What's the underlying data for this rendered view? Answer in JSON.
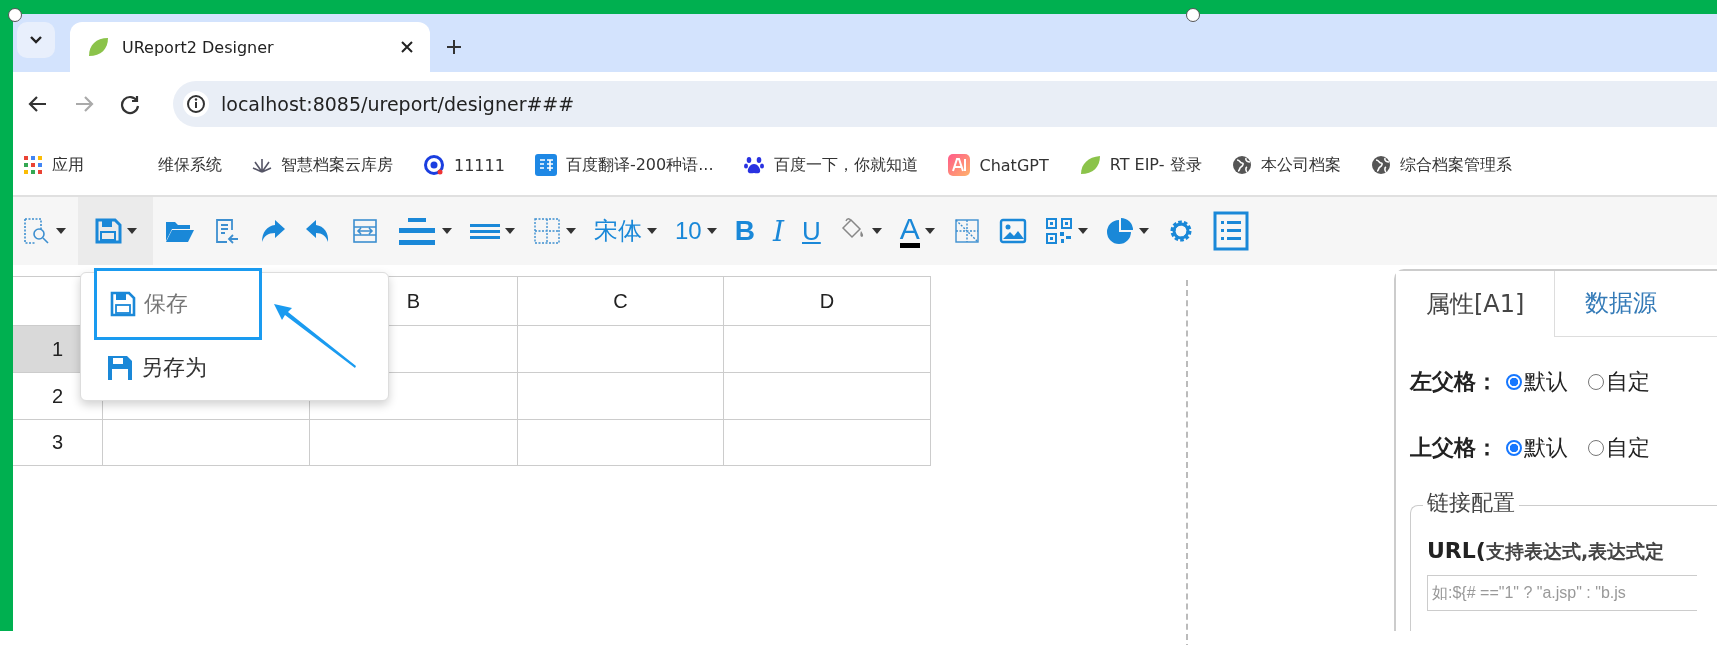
{
  "browser": {
    "tab": {
      "title": "UReport2 Designer",
      "selected": true
    },
    "nav": [
      {
        "kind": "back",
        "disabled": false
      },
      {
        "kind": "forward",
        "disabled": true
      },
      {
        "kind": "reload",
        "disabled": false
      }
    ],
    "url": "localhost:8085/ureport/designer###",
    "bookmarks": [
      {
        "kind": "apps",
        "label": "应用"
      },
      {
        "kind": "none",
        "label": "维保系统"
      },
      {
        "kind": "plant",
        "label": "智慧档案云库房"
      },
      {
        "kind": "ring",
        "label": "11111"
      },
      {
        "kind": "translate",
        "label": "百度翻译-200种语..."
      },
      {
        "kind": "paw",
        "label": "百度一下，你就知道"
      },
      {
        "kind": "ai",
        "label": "ChatGPT"
      },
      {
        "kind": "leaf",
        "label": "RT EIP- 登录"
      },
      {
        "kind": "globe",
        "label": "本公司档案"
      },
      {
        "kind": "globe",
        "label": "综合档案管理系"
      }
    ]
  },
  "toolbar": [
    {
      "kind": "preview",
      "dropdown": true,
      "pressed": false
    },
    {
      "kind": "save",
      "dropdown": true,
      "pressed": true
    },
    {
      "kind": "open",
      "dropdown": false,
      "pressed": false
    },
    {
      "kind": "import",
      "dropdown": false,
      "pressed": false
    },
    {
      "kind": "redo",
      "dropdown": false,
      "pressed": false
    },
    {
      "kind": "undo",
      "dropdown": false,
      "pressed": false
    },
    {
      "kind": "merge",
      "dropdown": false,
      "pressed": false
    },
    {
      "kind": "align",
      "dropdown": true,
      "pressed": false
    },
    {
      "kind": "valign",
      "dropdown": true,
      "pressed": false
    },
    {
      "kind": "border",
      "dropdown": true,
      "pressed": false
    },
    {
      "kind": "text",
      "text": "宋体",
      "dropdown": true,
      "pressed": false
    },
    {
      "kind": "text",
      "text": "10",
      "dropdown": true,
      "pressed": false
    },
    {
      "kind": "bold",
      "text": "B",
      "dropdown": false,
      "pressed": false
    },
    {
      "kind": "italic",
      "text": "I",
      "dropdown": false,
      "pressed": false
    },
    {
      "kind": "underline",
      "text": "U",
      "dropdown": false,
      "pressed": false
    },
    {
      "kind": "fill",
      "dropdown": true,
      "pressed": false
    },
    {
      "kind": "color",
      "text": "A",
      "dropdown": true,
      "pressed": false
    },
    {
      "kind": "noborder",
      "dropdown": false,
      "pressed": false
    },
    {
      "kind": "image",
      "dropdown": false,
      "pressed": false
    },
    {
      "kind": "qr",
      "dropdown": true,
      "pressed": false
    },
    {
      "kind": "chart",
      "dropdown": true,
      "pressed": false
    },
    {
      "kind": "gear",
      "dropdown": false,
      "pressed": false
    },
    {
      "kind": "list",
      "dropdown": false,
      "pressed": false
    }
  ],
  "save_menu": {
    "items": [
      {
        "kind": "save",
        "label": "保存",
        "selected": true
      },
      {
        "kind": "save_as",
        "label": "另存为",
        "selected": false
      }
    ]
  },
  "grid": {
    "columns": [
      {
        "label": "B"
      },
      {
        "label": "C"
      },
      {
        "label": "D"
      }
    ],
    "rows": [
      {
        "number": "1",
        "selected": true
      },
      {
        "number": "2",
        "selected": false
      },
      {
        "number": "3",
        "selected": false
      }
    ]
  },
  "panel": {
    "tabs": [
      {
        "label": "属性[A1]",
        "selected": true
      },
      {
        "label": "数据源",
        "selected": false
      }
    ],
    "parent_rows": [
      {
        "label": "左父格：",
        "options": [
          {
            "label": "默认",
            "selected": true
          },
          {
            "label": "自定",
            "selected": false
          }
        ]
      },
      {
        "label": "上父格：",
        "options": [
          {
            "label": "默认",
            "selected": true
          },
          {
            "label": "自定",
            "selected": false
          }
        ]
      }
    ],
    "link_config": {
      "legend": "链接配置",
      "url_label": "URL(",
      "url_hint": "支持表达式,表达式定",
      "placeholder": "如:${# ==\"1\" ? \"a.jsp\" : \"b.js"
    }
  }
}
